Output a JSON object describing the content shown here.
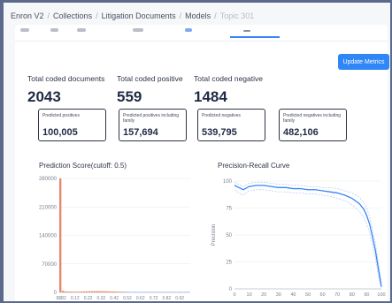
{
  "breadcrumb": {
    "items": [
      "Enron V2",
      "Collections",
      "Litigation Documents",
      "Models"
    ],
    "current": "Topic 301"
  },
  "toolbar": {
    "update_label": "Update Metrics"
  },
  "stats": [
    {
      "label": "Total coded documents",
      "value": "2043"
    },
    {
      "label": "Total coded positive",
      "value": "559"
    },
    {
      "label": "Total coded negative",
      "value": "1484"
    }
  ],
  "predictions": [
    {
      "label": "Predicted positives",
      "value": "100,005"
    },
    {
      "label": "Predicted positives including family",
      "value": "157,694"
    },
    {
      "label": "Predicted negatives",
      "value": "539,795"
    },
    {
      "label": "Predicted negatives including family",
      "value": "482,106"
    }
  ],
  "colors": {
    "accent": "#2f86f6",
    "histogram": "#e8876a",
    "curve": "#3b82f6",
    "curve_band": "#a9c6f5"
  },
  "chart_data": [
    {
      "type": "bar",
      "title": "Prediction Score(cutoff: 0.5)",
      "xlabel": "",
      "ylabel": "",
      "ylim": [
        0,
        280000
      ],
      "ytick_labels": [
        "0",
        "70000",
        "140000",
        "210000",
        "280000"
      ],
      "xtick_labels": [
        "0.0",
        "0.02",
        "0.12",
        "0.22",
        "0.32",
        "0.42",
        "0.52",
        "0.62",
        "0.72",
        "0.82",
        "0.92"
      ],
      "bins": [
        0.0,
        0.02,
        0.04,
        0.06,
        0.08,
        0.1,
        0.12,
        0.14,
        0.16,
        0.18,
        0.2,
        0.22,
        0.24,
        0.26,
        0.28,
        0.3,
        0.32,
        0.34,
        0.36,
        0.38,
        0.4,
        0.42,
        0.44,
        0.46,
        0.48,
        0.5
      ],
      "series": [
        {
          "values": [
            280000,
            4000,
            2500,
            2200,
            2000,
            1800,
            1700,
            1900,
            2100,
            2400,
            2600,
            2800,
            3000,
            3100,
            3200,
            3100,
            3000,
            2900,
            2700,
            2500,
            2400,
            2200,
            2000,
            1800,
            1600,
            1400
          ]
        },
        {
          "x": [
            0.5,
            0.55,
            0.6,
            0.65,
            0.7,
            0.75,
            0.8,
            0.85,
            0.9,
            0.95
          ],
          "values": [
            2000,
            1800,
            1600,
            1400,
            1300,
            1100,
            900,
            700,
            500,
            300
          ]
        }
      ]
    },
    {
      "type": "line",
      "title": "Precision-Recall Curve",
      "xlabel": "",
      "ylabel": "Precision",
      "xlim": [
        0,
        100
      ],
      "ylim": [
        0,
        100
      ],
      "xtick_labels": [
        "0",
        "10",
        "20",
        "30",
        "40",
        "50",
        "60",
        "70",
        "80",
        "90",
        "100"
      ],
      "ytick_labels": [
        "0",
        "25",
        "50",
        "75",
        "100"
      ],
      "series": [
        {
          "x": [
            0,
            3,
            6,
            10,
            15,
            20,
            25,
            30,
            35,
            40,
            45,
            50,
            55,
            60,
            65,
            70,
            75,
            80,
            85,
            88,
            90,
            92,
            94,
            96,
            98,
            100
          ],
          "y": [
            96,
            94,
            92,
            95,
            96,
            96,
            95,
            94,
            94,
            93,
            93,
            92,
            92,
            91,
            90,
            89,
            87,
            84,
            79,
            74,
            68,
            60,
            48,
            35,
            18,
            2
          ]
        }
      ],
      "band_upper": [
        99,
        97,
        95,
        98,
        99,
        99,
        98,
        97,
        97,
        96,
        96,
        95,
        95,
        94,
        94,
        93,
        91,
        89,
        85,
        80,
        75,
        67,
        55,
        42,
        24,
        6
      ],
      "band_lower": [
        92,
        89,
        87,
        91,
        92,
        92,
        91,
        90,
        90,
        89,
        89,
        88,
        88,
        87,
        86,
        84,
        82,
        78,
        72,
        66,
        60,
        52,
        40,
        28,
        12,
        0
      ]
    }
  ]
}
